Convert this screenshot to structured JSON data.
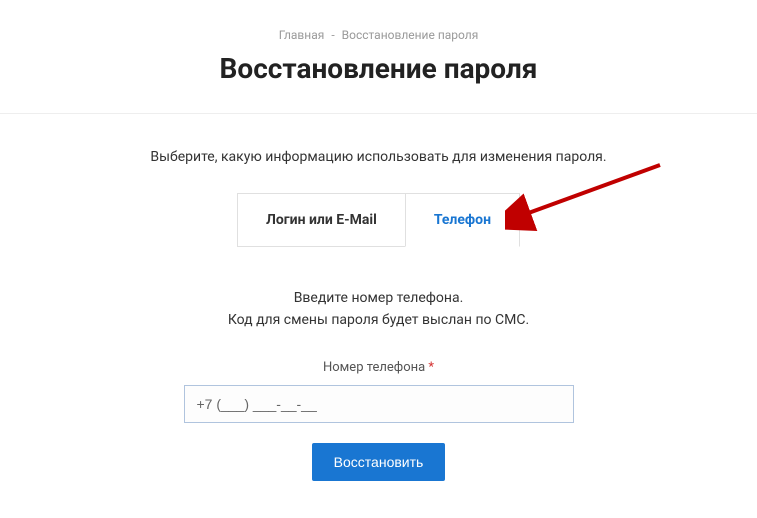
{
  "breadcrumb": {
    "home": "Главная",
    "separator": "-",
    "current": "Восстановление пароля"
  },
  "page_title": "Восстановление пароля",
  "instructions": "Выберите, какую информацию использовать для изменения пароля.",
  "tabs": {
    "login_email": "Логин или E-Mail",
    "phone": "Телефон"
  },
  "panel": {
    "line1": "Введите номер телефона.",
    "line2": "Код для смены пароля будет выслан по СМС."
  },
  "field": {
    "label": "Номер телефона",
    "required_mark": "*",
    "value": "+7 (___) ___-__-__"
  },
  "submit_label": "Восстановить",
  "colors": {
    "accent": "#1976d2",
    "required": "#d32f2f",
    "arrow": "#c00000"
  }
}
